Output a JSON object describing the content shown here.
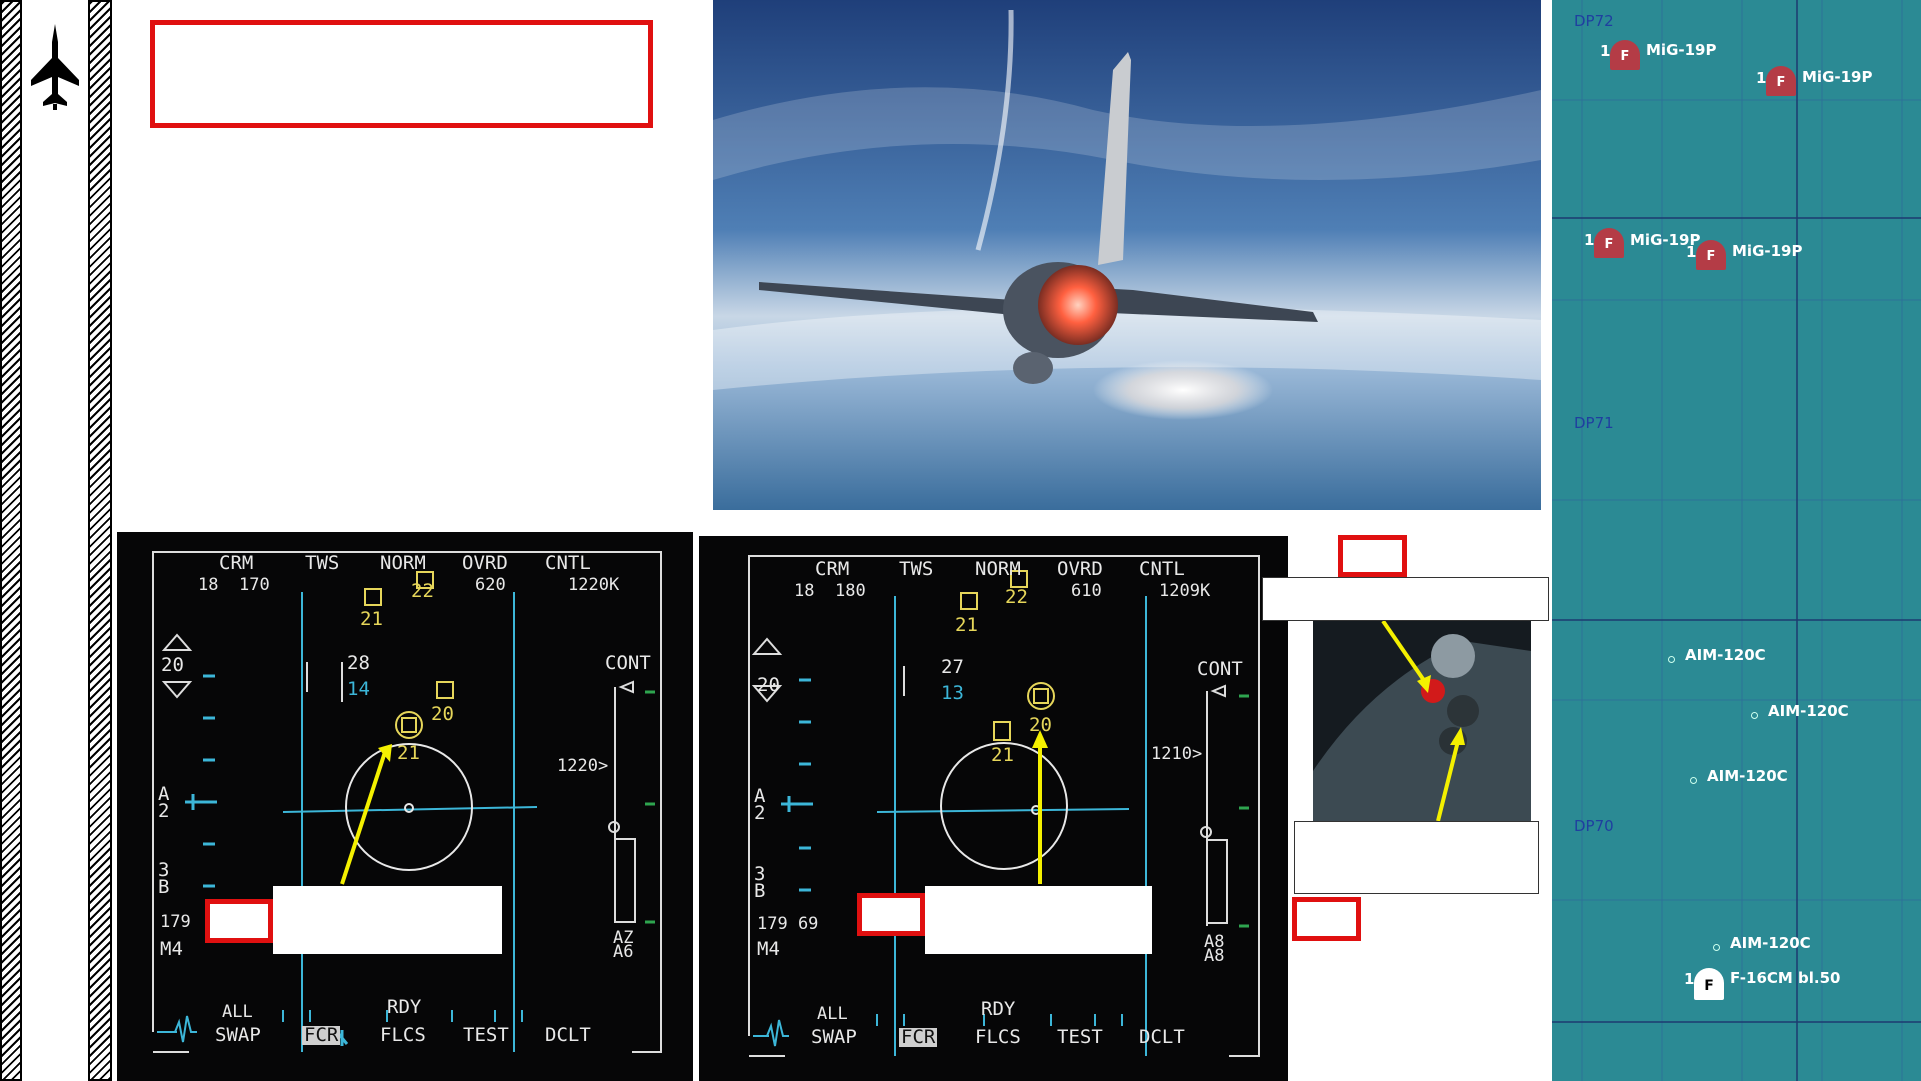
{
  "sidebar": {
    "icon": "jet-silhouette-icon"
  },
  "photo": {
    "subject": "F-16 fighter jet firing missile in flight"
  },
  "colors": {
    "callout_red": "#e01010",
    "arrow_yellow": "#f4f000",
    "map_bg": "#2b8a94",
    "mfd_bg": "#060607"
  },
  "mfd_left": {
    "crm": "CRM",
    "tws": "TWS",
    "norm": "NORM",
    "ovrd": "OVRD",
    "cntl": "CNTL",
    "alt_a": "18",
    "alt_b": "170",
    "speed": "620",
    "range_k": "1220K",
    "elev_bars": "20",
    "tgt_28": "28",
    "tgt_14": "14",
    "trk_21": "21",
    "trk_22": "22",
    "trk_20": "20",
    "trk_21b": "21",
    "cont": "CONT",
    "range_marker": "1220>",
    "a2": "A\n2",
    "b3": "3\nB",
    "hdg": "179",
    "m4": "M4",
    "az": "AZ\nA6",
    "all": "ALL",
    "rdy": "RDY",
    "swap": "SWAP",
    "fcr": "FCR",
    "flcs": "FLCS",
    "test": "TEST",
    "dclt": "DCLT"
  },
  "mfd_right": {
    "crm": "CRM",
    "tws": "TWS",
    "norm": "NORM",
    "ovrd": "OVRD",
    "cntl": "CNTL",
    "alt_a": "18",
    "alt_b": "180",
    "speed": "610",
    "range_k": "1209K",
    "elev_bars": "20",
    "tgt_27": "27",
    "tgt_13": "13",
    "trk_21": "21",
    "trk_22": "22",
    "trk_20": "20",
    "trk_21b": "21",
    "cont": "CONT",
    "range_marker": "1210>",
    "a2": "A\n2",
    "b3": "3\nB",
    "hdg": "179 69",
    "m4": "M4",
    "az": "A8\nA8",
    "all": "ALL",
    "rdy": "RDY",
    "swap": "SWAP",
    "fcr": "FCR",
    "flcs": "FLCS",
    "test": "TEST",
    "dclt": "DCLT"
  },
  "map": {
    "grid_labels": [
      "DP72",
      "DP71",
      "DP70"
    ],
    "units": [
      {
        "count": "1",
        "marker": "F",
        "name": "MiG-19P"
      },
      {
        "count": "1",
        "marker": "F",
        "name": "MiG-19P"
      },
      {
        "count": "1",
        "marker": "F",
        "name": "MiG-19P"
      },
      {
        "count": "1",
        "marker": "F",
        "name": "MiG-19P"
      }
    ],
    "missiles": [
      "AIM-120C",
      "AIM-120C",
      "AIM-120C",
      "AIM-120C"
    ],
    "player": {
      "count": "1",
      "marker": "F",
      "name": "F-16CM bl.50"
    }
  }
}
